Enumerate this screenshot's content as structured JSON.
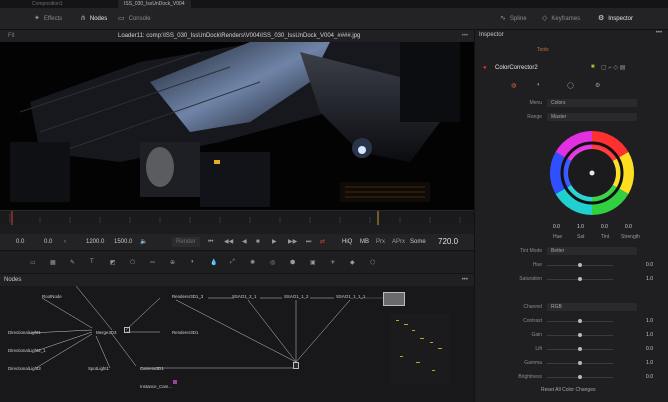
{
  "window_tabs": [
    "Composition1",
    "ISS_030_IssUnDock_V004"
  ],
  "toolbar": {
    "effects_label": "Effects",
    "nodes_label": "Nodes",
    "console_label": "Console",
    "spline_label": "Spline",
    "keyframes_label": "Keyframes",
    "inspector_label": "Inspector"
  },
  "viewer": {
    "options_label": "Fit",
    "title": "Loader11: comp:\\ISS_030_IssUnDock\\Renders\\V004\\ISS_030_IssUnDock_V004_####.jpg"
  },
  "transport": {
    "current_frame": "0.0",
    "start": "0.0",
    "render_start": "1200.0",
    "render_end": "1500.0",
    "render_label": "Render",
    "hiq_label": "HiQ",
    "mb_label": "MB",
    "prx_label": "Prx",
    "aprx_label": "APrx",
    "some_label": "Some",
    "end_frame": "720.0"
  },
  "nodes_panel": {
    "title": "Nodes",
    "nodes": [
      "RootNode",
      "DirectionalLight1",
      "DirectionalLight2_1",
      "DirectionalLight3",
      "Merge3D3",
      "SpotLight1",
      "Camera3D1",
      "Instance_Cam...",
      "Renderer3D1_3",
      "Renderer3D1",
      "SSAO1_2_1",
      "SSAO1_1_2",
      "SSAO1_1_1_1"
    ]
  },
  "inspector": {
    "title": "Inspector",
    "tools_tab": "Tools",
    "tool_name": "ColorCorrector2",
    "menu_label": "Menu",
    "menu_value": "Colors",
    "range_label": "Range",
    "range_value": "Master",
    "wheel_values": [
      "0.0",
      "1.0",
      "0.0",
      "0.0"
    ],
    "wheel_labels": [
      "Hue",
      "Sat",
      "Tint",
      "Strength"
    ],
    "tint_mode_label": "Tint Mode",
    "tint_mode_value": "Better",
    "hue_label": "Hue",
    "hue_value": "0.0",
    "saturation_label": "Saturation",
    "saturation_value": "1.0",
    "channel_label": "Channel",
    "channel_value": "RGB",
    "contrast_label": "Contrast",
    "contrast_value": "1.0",
    "gain_label": "Gain",
    "gain_value": "1.0",
    "lift_label": "Lift",
    "lift_value": "0.0",
    "gamma_label": "Gamma",
    "gamma_value": "1.0",
    "brightness_label": "Brightness",
    "brightness_value": "0.0",
    "reset_label": "Reset All Color Changes"
  }
}
